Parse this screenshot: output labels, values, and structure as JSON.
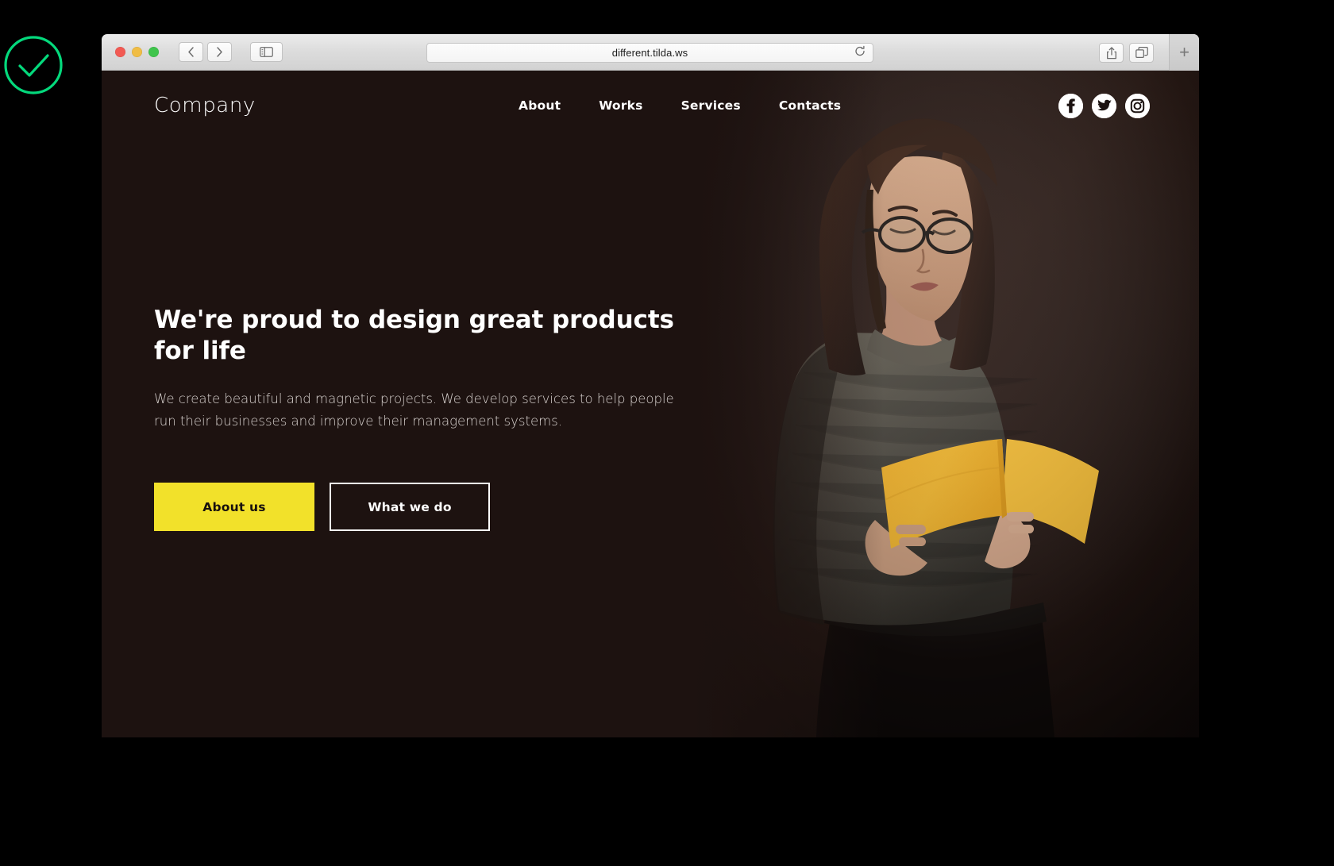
{
  "badge": {
    "icon": "check-circle-icon",
    "color": "#04d97c"
  },
  "browser": {
    "traffic_lights": [
      "close",
      "minimize",
      "zoom"
    ],
    "back_label": "‹",
    "forward_label": "›",
    "sidebar_icon": "sidebar-icon",
    "url": "different.tilda.ws",
    "reload_icon": "reload-icon",
    "share_icon": "share-icon",
    "tabs_icon": "show-tabs-icon",
    "new_tab_label": "+"
  },
  "site": {
    "logo": "Company",
    "nav": [
      {
        "label": "About"
      },
      {
        "label": "Works"
      },
      {
        "label": "Services"
      },
      {
        "label": "Contacts"
      }
    ],
    "socials": [
      {
        "name": "facebook-icon"
      },
      {
        "name": "twitter-icon"
      },
      {
        "name": "instagram-icon"
      }
    ],
    "hero": {
      "title": "We're proud to design great products for life",
      "subtitle": "We create beautiful and magnetic projects. We develop services to help people run their businesses and improve their management systems.",
      "primary_button": "About us",
      "secondary_button": "What we do",
      "background_color": "#1d1210",
      "accent_color": "#f2e12a",
      "photo_alt": "Woman with glasses reading a yellow book against a dark brown wall"
    }
  }
}
